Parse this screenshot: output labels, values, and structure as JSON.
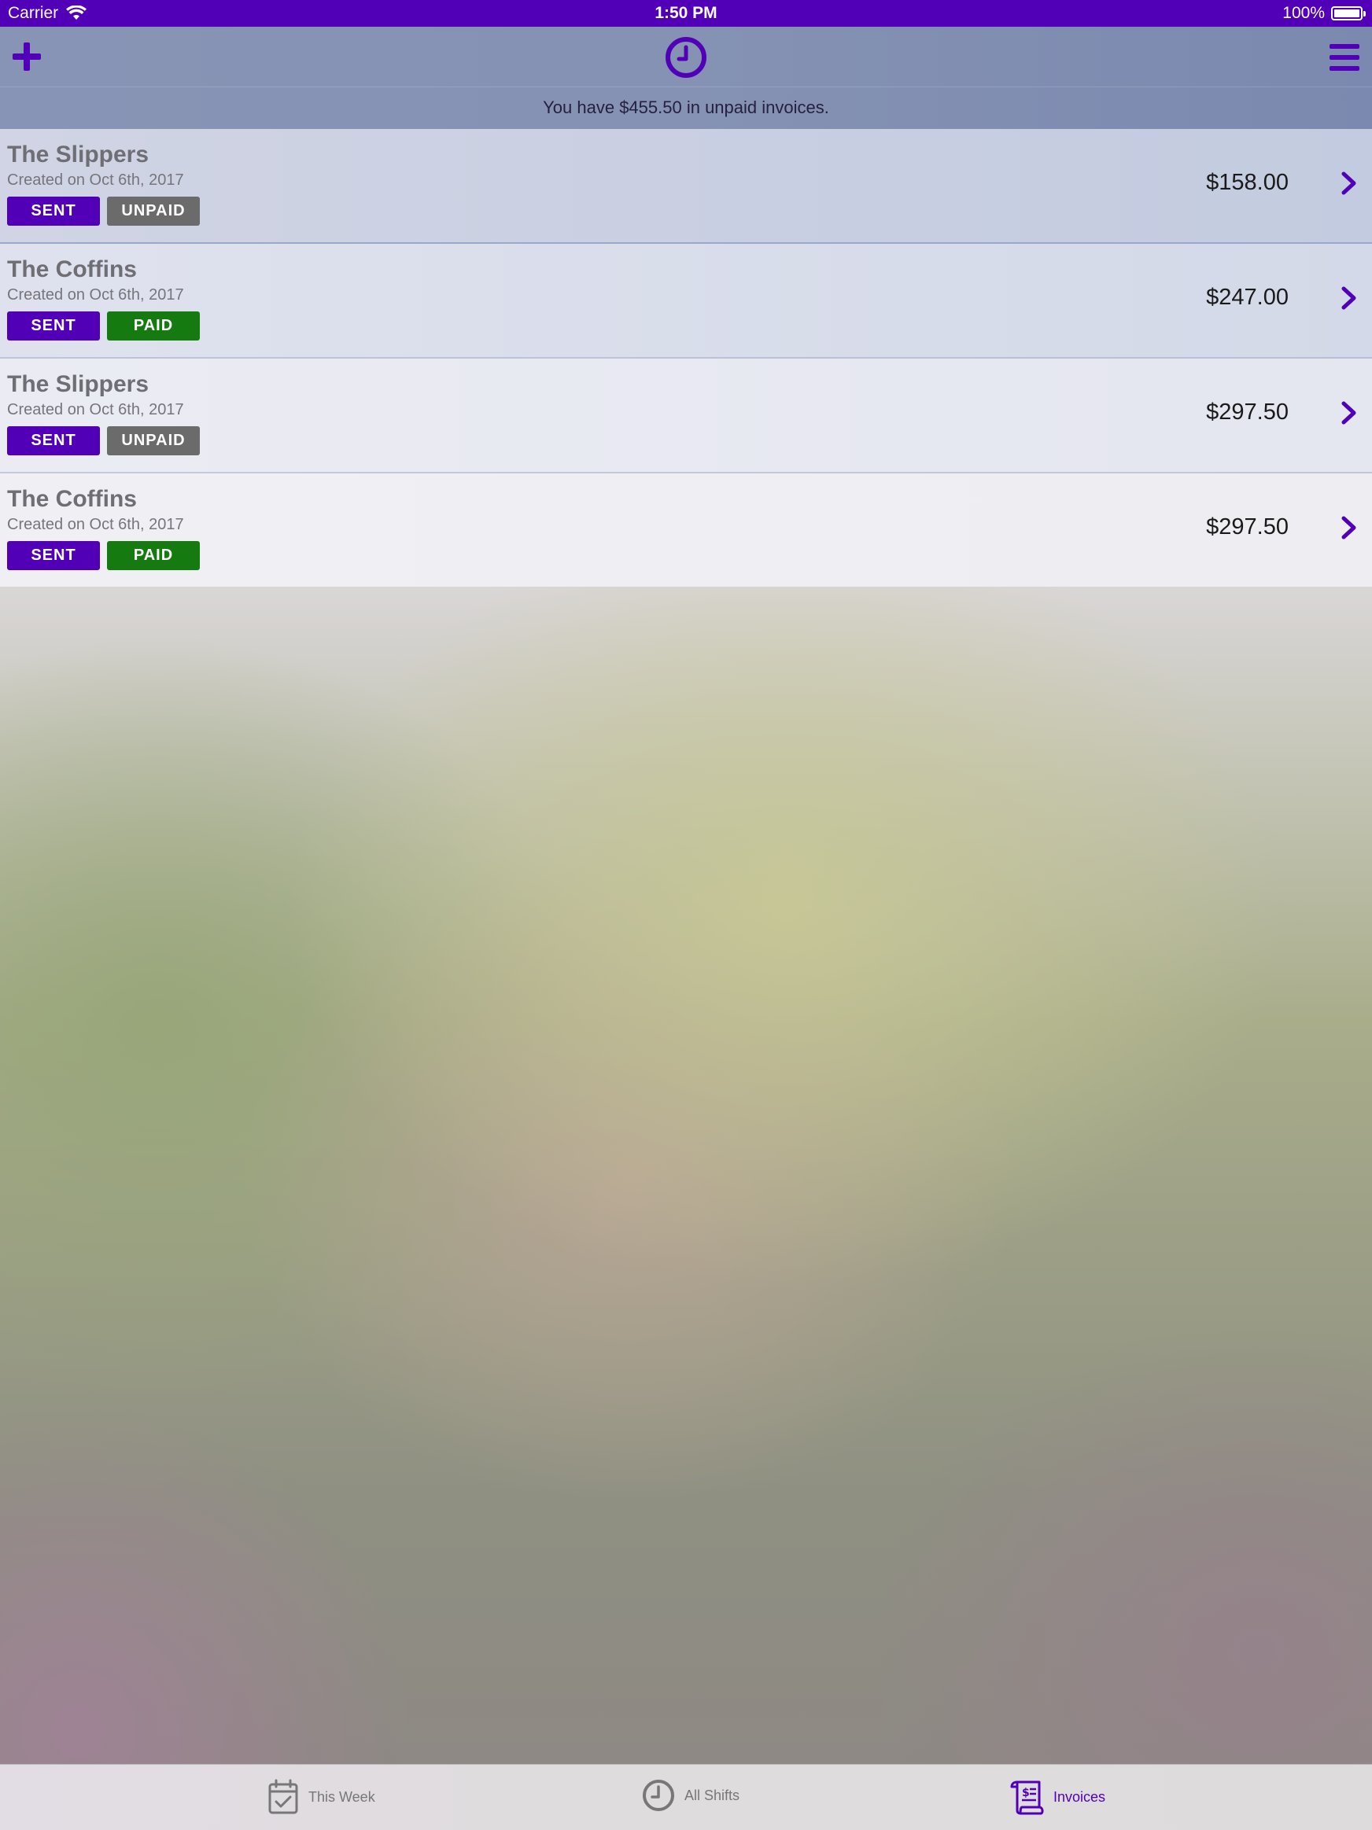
{
  "status_bar": {
    "carrier": "Carrier",
    "time": "1:50 PM",
    "battery": "100%"
  },
  "nav": {
    "summary": "You have $455.50 in unpaid invoices."
  },
  "invoices": [
    {
      "client": "The Slippers",
      "created": "Created on Oct 6th, 2017",
      "sent_label": "SENT",
      "status_label": "UNPAID",
      "amount": "$158.00"
    },
    {
      "client": "The Coffins",
      "created": "Created on Oct 6th, 2017",
      "sent_label": "SENT",
      "status_label": "PAID",
      "amount": "$247.00"
    },
    {
      "client": "The Slippers",
      "created": "Created on Oct 6th, 2017",
      "sent_label": "SENT",
      "status_label": "UNPAID",
      "amount": "$297.50"
    },
    {
      "client": "The Coffins",
      "created": "Created on Oct 6th, 2017",
      "sent_label": "SENT",
      "status_label": "PAID",
      "amount": "$297.50"
    }
  ],
  "tabs": [
    {
      "label": "This Week",
      "icon": "calendar-check-icon",
      "active": false
    },
    {
      "label": "All Shifts",
      "icon": "clock-icon",
      "active": false
    },
    {
      "label": "Invoices",
      "icon": "invoice-scroll-icon",
      "active": true
    }
  ],
  "colors": {
    "accent": "#5200b8",
    "paid": "#157a10",
    "unpaid": "#6b6b6b"
  }
}
